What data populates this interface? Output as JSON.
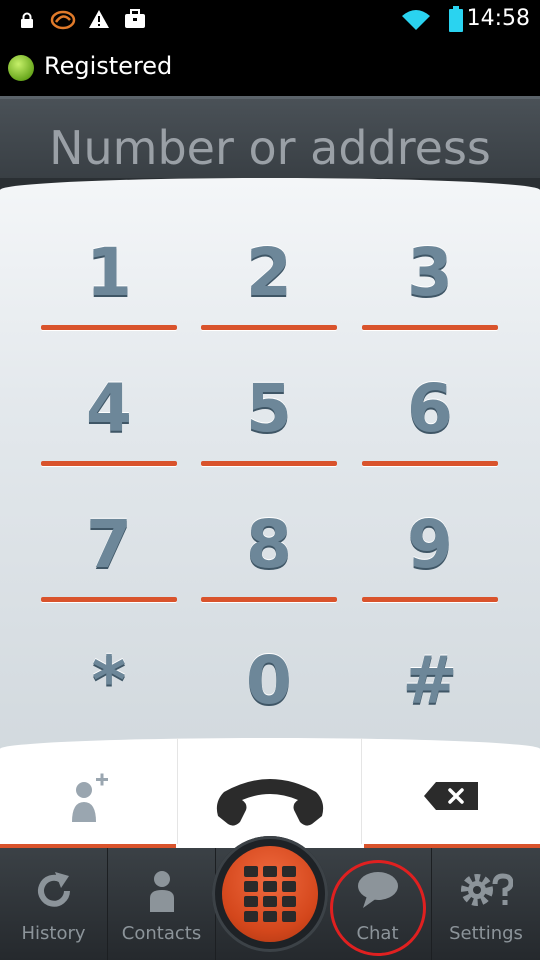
{
  "status_bar": {
    "time": "14:58",
    "icons": [
      "lock-icon",
      "app-logo-icon",
      "warning-icon",
      "briefcase-icon",
      "wifi-icon",
      "battery-icon"
    ]
  },
  "registration": {
    "status": "Registered",
    "status_color": "#6aa81e"
  },
  "address": {
    "placeholder": "Number or address",
    "value": ""
  },
  "keypad": {
    "keys": [
      "1",
      "2",
      "3",
      "4",
      "5",
      "6",
      "7",
      "8",
      "9",
      "*",
      "0",
      "#"
    ],
    "accent_color": "#d9532c"
  },
  "actions": {
    "add_contact_icon": "add-contact-icon",
    "call_icon": "phone-handset-icon",
    "backspace_icon": "backspace-icon"
  },
  "nav": {
    "history": "History",
    "contacts": "Contacts",
    "dialer_icon": "dialpad-icon",
    "chat": "Chat",
    "settings": "Settings"
  }
}
